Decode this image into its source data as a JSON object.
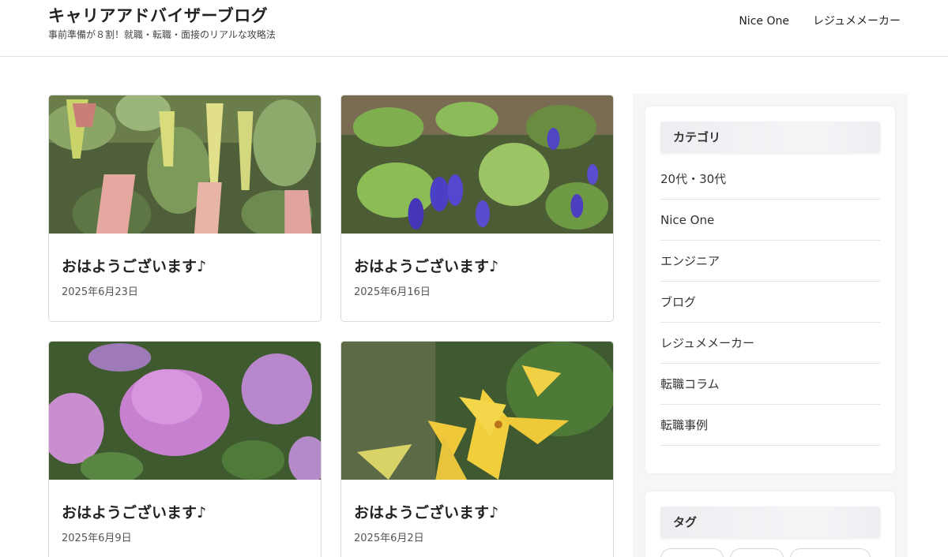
{
  "header": {
    "title": "キャリアアドバイザーブログ",
    "description": "事前準備が８割！就職・転職・面接のリアルな攻略法",
    "nav": [
      {
        "label": "Nice One"
      },
      {
        "label": "レジュメメーカー"
      }
    ]
  },
  "posts": [
    {
      "title": "おはようございます♪",
      "date": "2025年6月23日",
      "image": "angel-trumpet-flowers"
    },
    {
      "title": "おはようございます♪",
      "date": "2025年6月16日",
      "image": "blue-salvia-flowers"
    },
    {
      "title": "おはようございます♪",
      "date": "2025年6月9日",
      "image": "pink-hydrangea-flowers"
    },
    {
      "title": "おはようございます♪",
      "date": "2025年6月2日",
      "image": "yellow-lily-flowers"
    }
  ],
  "sidebar": {
    "categories": {
      "heading": "カテゴリ",
      "items": [
        {
          "label": "20代・30代"
        },
        {
          "label": "Nice One"
        },
        {
          "label": "エンジニア"
        },
        {
          "label": "ブログ"
        },
        {
          "label": "レジュメメーカー"
        },
        {
          "label": "転職コラム"
        },
        {
          "label": "転職事例"
        }
      ]
    },
    "tags": {
      "heading": "タグ"
    }
  },
  "colors": {
    "text": "#333333",
    "border": "#d9d9d9",
    "sidebar_bg": "#f5f6f7"
  }
}
